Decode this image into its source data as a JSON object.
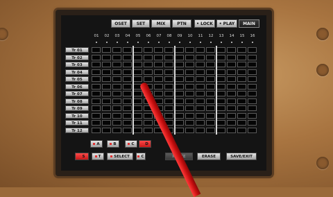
{
  "toolbar": {
    "buttons": [
      {
        "label": "OSET",
        "active": false
      },
      {
        "label": "SET",
        "active": false
      },
      {
        "label": "MIX",
        "active": false
      },
      {
        "label": "PTN",
        "active": false
      },
      {
        "label": "• LOCK",
        "active": false
      },
      {
        "label": "• PLAY",
        "active": false
      },
      {
        "label": "MAIN",
        "active": true
      }
    ]
  },
  "columns": [
    "01",
    "02",
    "03",
    "04",
    "05",
    "06",
    "07",
    "08",
    "09",
    "10",
    "11",
    "12",
    "13",
    "14",
    "15",
    "16"
  ],
  "tracks": [
    "Tr 01",
    "Tr 02",
    "Tr 03",
    "Tr 04",
    "Tr 05",
    "Tr 06",
    "Tr 07",
    "Tr 08",
    "Tr 09",
    "Tr 10",
    "Tr 11",
    "Tr 12"
  ],
  "pattern_row": [
    {
      "label": "A"
    },
    {
      "label": "B"
    },
    {
      "label": "C"
    },
    {
      "label": "D"
    }
  ],
  "bottom_row": [
    {
      "label": "S"
    },
    {
      "label": "T"
    },
    {
      "label": "SELECT"
    },
    {
      "label": "C"
    },
    {
      "label": "PASTE"
    },
    {
      "label": "ERASE"
    },
    {
      "label": "SAVE/EXIT"
    }
  ],
  "colors": {
    "accent_red": "#e23030",
    "screen_bg": "#141414",
    "beat_line": "#d8d8d8"
  }
}
